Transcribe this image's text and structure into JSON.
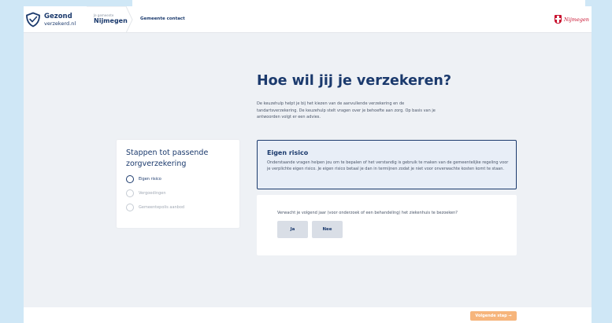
{
  "header": {
    "logo_line1": "Gezond",
    "logo_line2": "verzekerd.nl",
    "crumb_label": "Je gemeente",
    "crumb_city": "Nijmegen",
    "nav_contact": "Gemeente contact",
    "city_logo_text": "Nijmegen"
  },
  "main": {
    "title": "Hoe wil jij je verzekeren?",
    "intro": "De keuzehulp helpt je bij het kiezen van de aanvullende verzekering en de tandartsverzekering. De keuzehulp stelt vragen over je behoefte aan zorg. Op basis van je antwoorden volgt er een advies."
  },
  "steps": {
    "title": "Stappen tot passende zorgverzekering",
    "items": [
      {
        "label": "Eigen risico",
        "active": true
      },
      {
        "label": "Vergoedingen",
        "active": false
      },
      {
        "label": "Gemeentepolis aanbod",
        "active": false
      }
    ]
  },
  "info": {
    "title": "Eigen risico",
    "text": "Onderstaande vragen helpen jou om te bepalen of het verstandig is gebruik te maken van de gemeentelijke regeling voor je verplichte eigen risico. Je eigen risico betaal je dan in termijnen zodat je niet voor onverwachte kosten komt te staan."
  },
  "question": {
    "text": "Verwacht je volgend jaar (voor onderzoek of een behandeling) het ziekenhuis te bezoeken?",
    "yes_label": "Ja",
    "no_label": "Nee"
  },
  "footer": {
    "next_label": "Volgende stap →"
  },
  "colors": {
    "brand_navy": "#1b3a6d",
    "page_bg": "#cfe7f6",
    "content_bg": "#eef1f5",
    "city_red": "#c8102e",
    "next_button": "#f6b57c"
  }
}
